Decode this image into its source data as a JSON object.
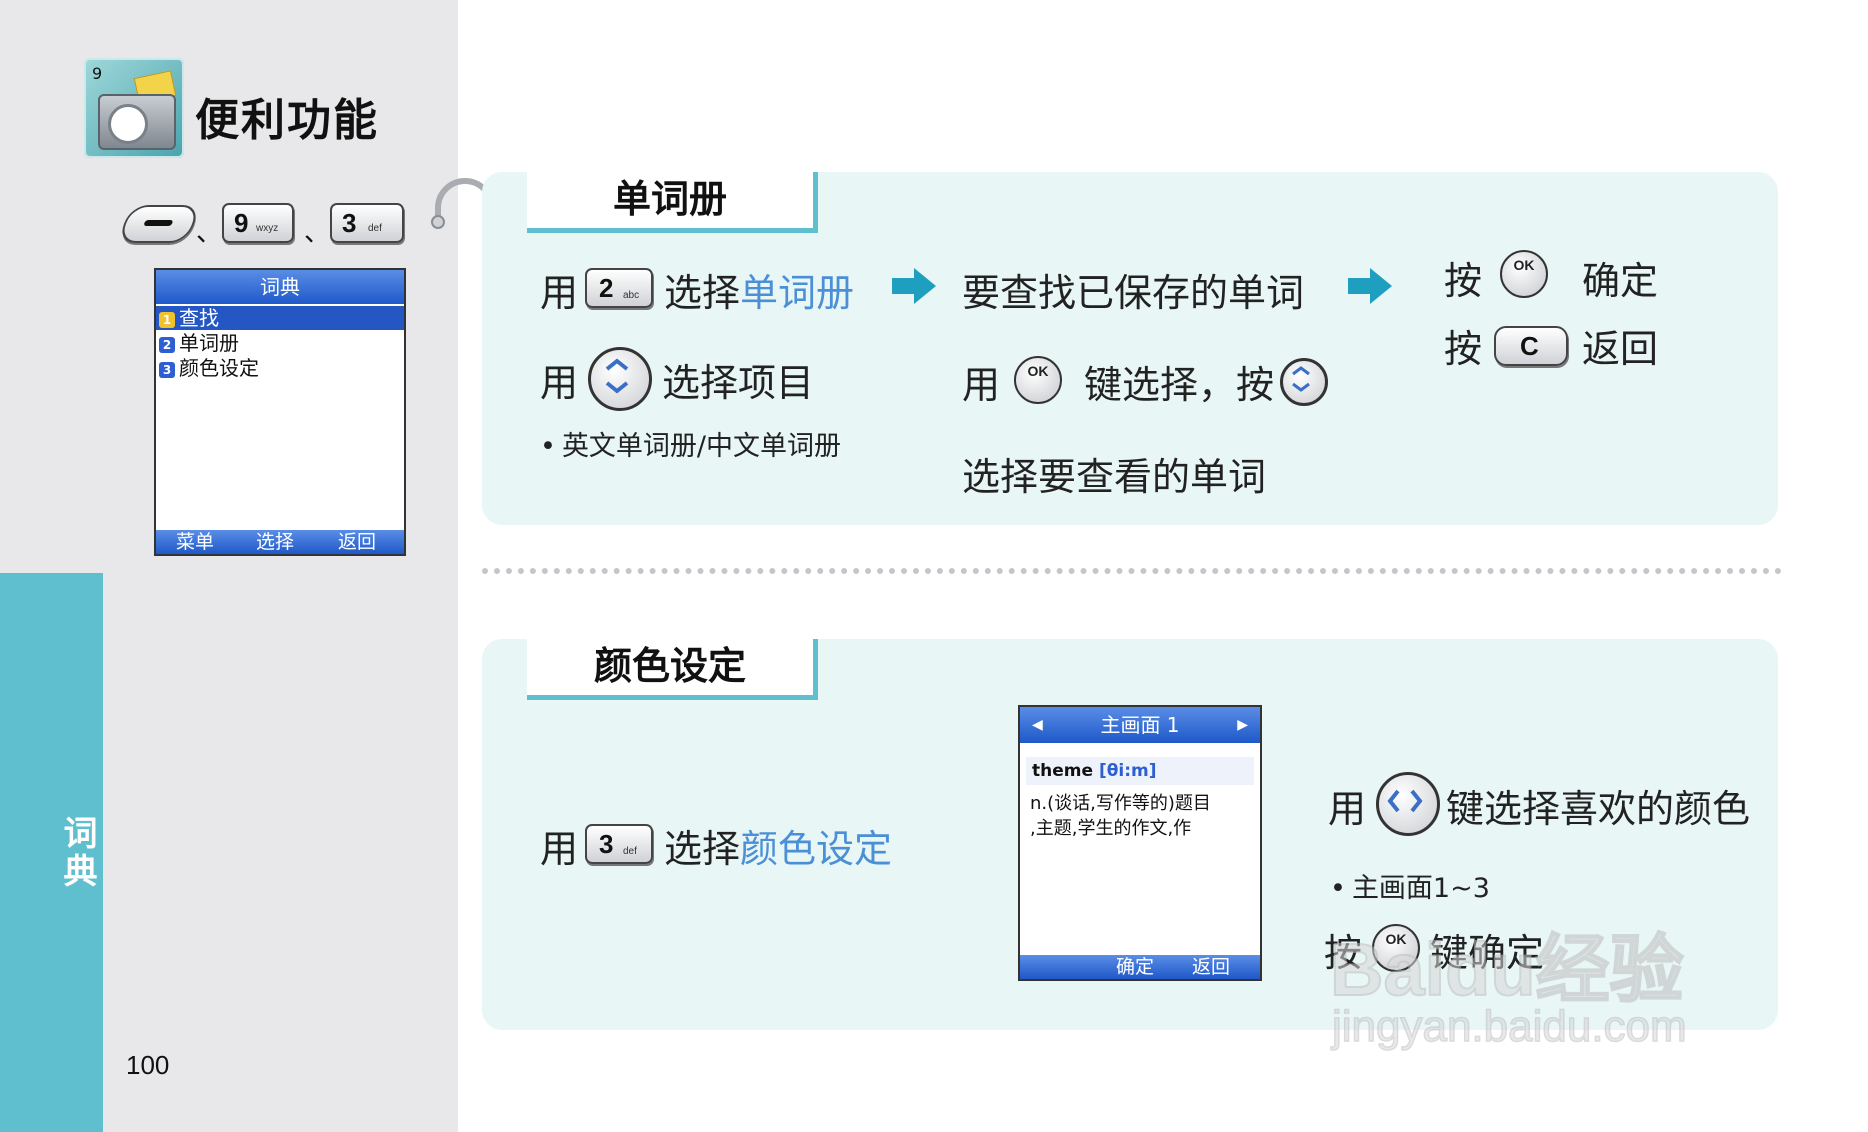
{
  "sidebar": {
    "tab_label": "词典",
    "page_number": "100"
  },
  "chapter": {
    "icon_number": "9",
    "title": "便利功能"
  },
  "key_sequence": {
    "separator": "、",
    "keys": [
      {
        "main": "9",
        "sub": "wxyz"
      },
      {
        "main": "3",
        "sub": "def"
      }
    ]
  },
  "phone_menu": {
    "title": "词典",
    "items": [
      {
        "index": "1",
        "label": "查找"
      },
      {
        "index": "2",
        "label": "单词册"
      },
      {
        "index": "3",
        "label": "颜色设定"
      }
    ],
    "softkeys": [
      "菜单",
      "选择",
      "返回"
    ]
  },
  "section_wordbook": {
    "tab_title": "单词册",
    "step1_line1": {
      "prefix": "用",
      "key_main": "2",
      "key_sub": "abc",
      "text": "选择",
      "highlight": "单词册"
    },
    "step1_line2": {
      "prefix": "用",
      "text": "选择项目"
    },
    "step1_bullet": "英文单词册/中文单词册",
    "step2_line1": "要查找已保存的单词",
    "step2_line2": {
      "prefix": "用",
      "ok_label": "OK",
      "text": "键选择，按"
    },
    "step2_line3": "选择要查看的单词",
    "step3_line1": {
      "prefix": "按",
      "ok_label": "OK",
      "text": "确定"
    },
    "step3_line2": {
      "prefix": "按",
      "key_label": "C",
      "text": "返回"
    }
  },
  "section_color": {
    "tab_title": "颜色设定",
    "step1": {
      "prefix": "用",
      "key_main": "3",
      "key_sub": "def",
      "text": "选择",
      "highlight": "颜色设定"
    },
    "phone_screen": {
      "title": "主画面 1",
      "word": "theme",
      "phonetic": "[θi:m]",
      "definition_line1": "n.(谈话,写作等的)题目",
      "definition_line2": ",主题,学生的作文,作",
      "softkeys": [
        "确定",
        "返回"
      ]
    },
    "step2_line": {
      "prefix": "用",
      "text": "键选择喜欢的颜色"
    },
    "step2_bullet": "主画面1~3",
    "step3_line": {
      "prefix": "按",
      "ok_label": "OK",
      "text": "键确定"
    }
  },
  "watermark": {
    "logo": "Baidu经验",
    "url": "jingyan.baidu.com"
  },
  "colors": {
    "accent": "#5fbfcf",
    "panel": "#e8f6f5",
    "link": "#4b8fd6",
    "screen_blue": "#2456c4"
  }
}
